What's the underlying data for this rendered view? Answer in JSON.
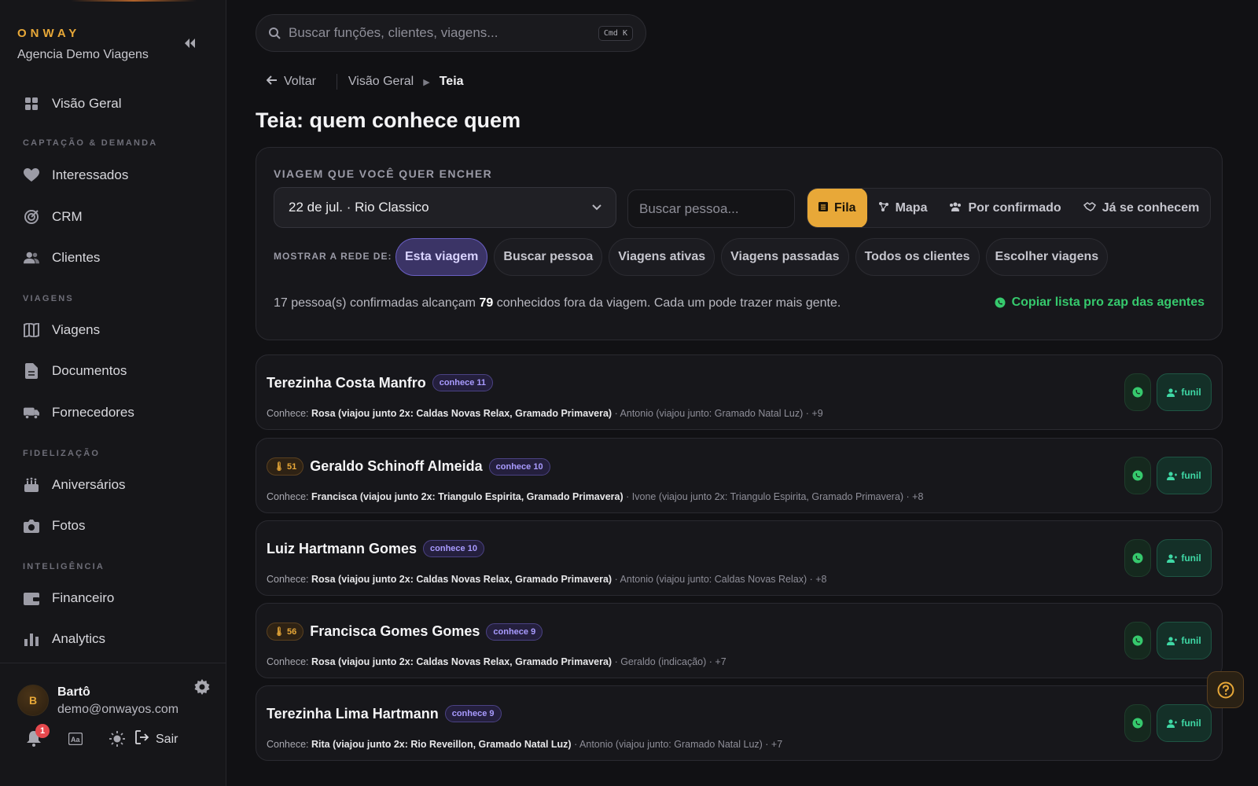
{
  "brand": {
    "logo": "ONWAY",
    "agency": "Agencia Demo Viagens"
  },
  "nav": {
    "overview": "Visão Geral",
    "section_capture": "CAPTAÇÃO & DEMANDA",
    "interested": "Interessados",
    "crm": "CRM",
    "clients": "Clientes",
    "section_trips": "VIAGENS",
    "trips": "Viagens",
    "documents": "Documentos",
    "suppliers": "Fornecedores",
    "section_loyalty": "FIDELIZAÇÃO",
    "birthdays": "Aniversários",
    "photos": "Fotos",
    "section_intel": "INTELIGÊNCIA",
    "finance": "Financeiro",
    "analytics": "Analytics"
  },
  "user": {
    "initial": "B",
    "name": "Bartô",
    "email": "demo@onwayos.com",
    "notifications": "1",
    "logout": "Sair"
  },
  "search": {
    "placeholder": "Buscar funções, clientes, viagens...",
    "shortcut": "Cmd K"
  },
  "breadcrumb": {
    "back": "Voltar",
    "parent": "Visão Geral",
    "current": "Teia"
  },
  "page_title": "Teia: quem conhece quem",
  "panel": {
    "trip_label": "VIAGEM QUE VOCÊ QUER ENCHER",
    "trip_selected": "22 de jul. · Rio Classico",
    "person_placeholder": "Buscar pessoa...",
    "views": {
      "fila": "Fila",
      "mapa": "Mapa",
      "por_confirmado": "Por confirmado",
      "ja_conhecem": "Já se conhecem"
    },
    "rede_label": "MOSTRAR A REDE DE:",
    "chips": {
      "esta_viagem": "Esta viagem",
      "buscar_pessoa": "Buscar pessoa",
      "ativas": "Viagens ativas",
      "passadas": "Viagens passadas",
      "todos": "Todos os clientes",
      "escolher": "Escolher viagens"
    },
    "summary_pre": "17 pessoa(s) confirmadas alcançam",
    "summary_count": "79",
    "summary_post": "conhecidos fora da viagem. Cada um pode trazer mais gente.",
    "copy_link": "Copiar lista pro zap das agentes"
  },
  "cards": [
    {
      "name": "Terezinha Costa Manfro",
      "badge": "conhece 11",
      "temp": "",
      "label": "Conhece:",
      "main": "Rosa (viajou junto 2x: Caldas Novas Relax, Gramado Primavera)",
      "rest": "· Antonio (viajou junto: Gramado Natal Luz) · +9",
      "funil": "funil"
    },
    {
      "name": "Geraldo Schinoff Almeida",
      "badge": "conhece 10",
      "temp": "51",
      "label": "Conhece:",
      "main": "Francisca (viajou junto 2x: Triangulo Espirita, Gramado Primavera)",
      "rest": "· Ivone (viajou junto 2x: Triangulo Espirita, Gramado Primavera) · +8",
      "funil": "funil"
    },
    {
      "name": "Luiz Hartmann Gomes",
      "badge": "conhece 10",
      "temp": "",
      "label": "Conhece:",
      "main": "Rosa (viajou junto 2x: Caldas Novas Relax, Gramado Primavera)",
      "rest": "· Antonio (viajou junto: Caldas Novas Relax) · +8",
      "funil": "funil"
    },
    {
      "name": "Francisca Gomes Gomes",
      "badge": "conhece 9",
      "temp": "56",
      "label": "Conhece:",
      "main": "Rosa (viajou junto 2x: Caldas Novas Relax, Gramado Primavera)",
      "rest": "· Geraldo (indicação) · +7",
      "funil": "funil"
    },
    {
      "name": "Terezinha Lima Hartmann",
      "badge": "conhece 9",
      "temp": "",
      "label": "Conhece:",
      "main": "Rita (viajou junto 2x: Rio Reveillon, Gramado Natal Luz)",
      "rest": "· Antonio (viajou junto: Gramado Natal Luz) · +7",
      "funil": "funil"
    }
  ],
  "colors": {
    "accent": "#e8a838",
    "whatsapp": "#36c96d",
    "funil": "#3fd8a5",
    "chip_active": "#3b3466"
  }
}
